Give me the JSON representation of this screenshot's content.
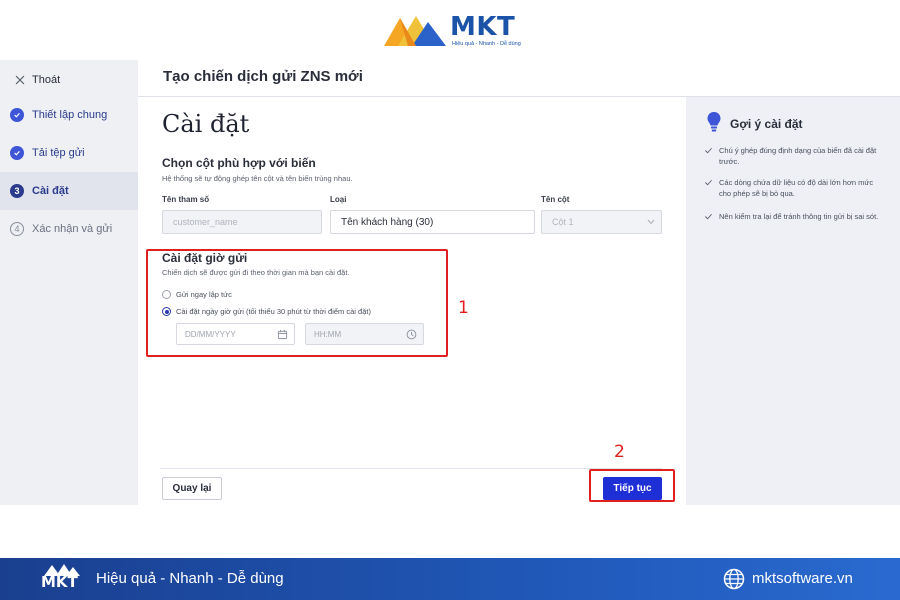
{
  "logo": {
    "brand": "MKT",
    "tagline": "Hiệu quả - Nhanh - Dễ dùng"
  },
  "sidebar": {
    "exit_label": "Thoát",
    "steps": [
      {
        "number": "1",
        "label": "Thiết lập chung",
        "state": "done"
      },
      {
        "number": "2",
        "label": "Tải tệp gửi",
        "state": "done"
      },
      {
        "number": "3",
        "label": "Cài đặt",
        "state": "active"
      },
      {
        "number": "4",
        "label": "Xác nhận và gửi",
        "state": "pending"
      }
    ]
  },
  "header": {
    "title": "Tạo chiến dịch gửi ZNS mới"
  },
  "main": {
    "title": "Cài đặt",
    "mapping": {
      "title": "Chọn cột phù hợp với biến",
      "description": "Hệ thống sẽ tự động ghép tên cột và tên biến trùng nhau.",
      "param_label": "Tên tham số",
      "type_label": "Loại",
      "column_label": "Tên cột",
      "param_value": "customer_name",
      "type_value": "Tên khách hàng (30)",
      "column_value": "Cột 1"
    },
    "schedule": {
      "title": "Cài đặt giờ gửi",
      "description": "Chiến dịch sẽ được gửi đi theo thời gian mà bạn cài đặt.",
      "option_now": "Gửi ngay lập tức",
      "option_scheduled": "Cài đặt ngày giờ gửi (tối thiểu 30 phút từ thời điểm cài đặt)",
      "selected": "scheduled",
      "date_placeholder": "DD/MM/YYYY",
      "time_placeholder": "HH:MM"
    },
    "back_label": "Quay lại",
    "next_label": "Tiếp tục"
  },
  "tips": {
    "title": "Gợi ý cài đặt",
    "items": [
      "Chú ý ghép đúng định dạng của biến đã cài đặt trước.",
      "Các dòng chứa dữ liệu có độ dài lớn hơn mức cho phép sẽ bị bỏ qua.",
      "Nên kiểm tra lại để tránh thông tin gửi bị sai sót."
    ]
  },
  "annotations": {
    "first": "1",
    "second": "2"
  },
  "banner": {
    "slogan": "Hiệu quả - Nhanh - Dễ dùng",
    "website": "mktsoftware.vn",
    "logo_text": "MKT"
  },
  "colors": {
    "primary_button": "#1e2fd6",
    "highlight": "#e02020",
    "step_done": "#3d55d6",
    "banner": "#1a3f8f"
  }
}
